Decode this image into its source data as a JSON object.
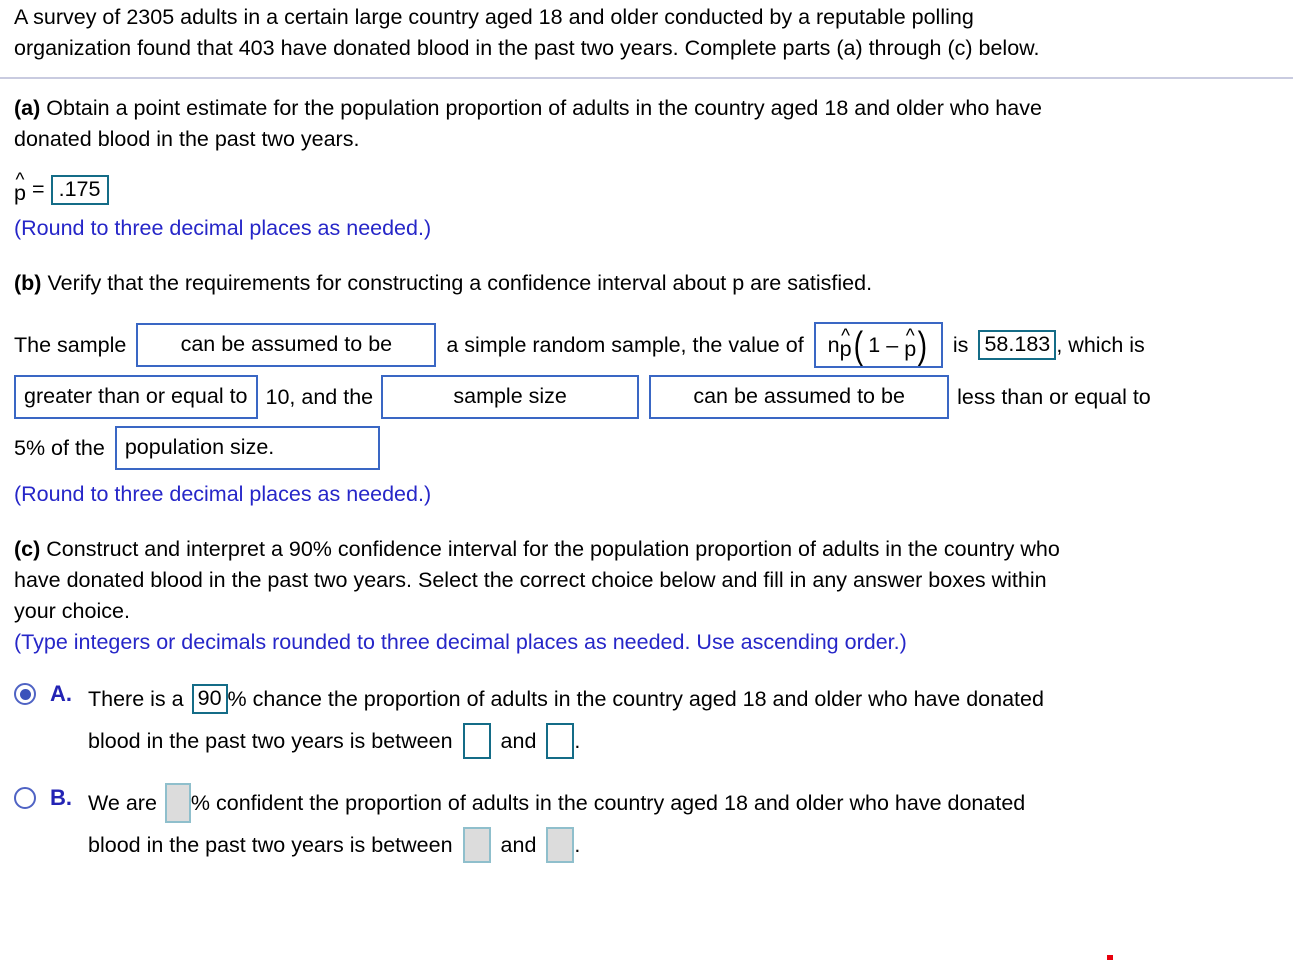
{
  "problem": {
    "line1": "A survey of 2305 adults in a certain large country aged 18 and older conducted by a reputable polling",
    "line2": "organization found that 403 have donated blood in the past two years. Complete parts (a) through (c) below."
  },
  "part_a": {
    "label": "(a)",
    "text_line1": "Obtain a point estimate for the population proportion of adults in the country aged 18 and older who have",
    "text_line2": "donated blood in the past two years.",
    "phat_symbol": "p",
    "equals": "=",
    "phat_value": ".175",
    "round_note": "(Round to three decimal places as needed.)"
  },
  "part_b": {
    "label": "(b)",
    "text": "Verify that the requirements for constructing a confidence interval about p are satisfied.",
    "line1": {
      "prefix": "The sample",
      "dropdown1": "can be assumed to be",
      "mid": "a simple random sample, the value of",
      "formula": {
        "n": "n",
        "phat1": "p",
        "open_paren": "(",
        "one": "1",
        "minus": "–",
        "phat2": "p",
        "close_paren": ")"
      },
      "is_word": "is",
      "value": "58.183",
      "suffix": ", which is"
    },
    "line2": {
      "dropdown2": "greater than or equal to",
      "mid1": "10, and the",
      "dropdown3": "sample size",
      "dropdown4": "can be assumed to be",
      "suffix": "less than or equal to"
    },
    "line3": {
      "prefix": "5% of the",
      "dropdown5": "population size."
    },
    "round_note": "(Round to three decimal places as needed.)"
  },
  "part_c": {
    "label": "(c)",
    "text_line1": "Construct and interpret a 90% confidence interval for the population proportion of adults in the country who",
    "text_line2": "have donated blood in the past two years. Select the correct choice below and fill in any answer boxes within",
    "text_line3": "your choice.",
    "round_note": "(Type integers or decimals rounded to three decimal places as needed. Use ascending order.)",
    "choices": [
      {
        "letter": "A.",
        "selected": true,
        "line1_before": "There is a",
        "value": "90",
        "line1_after": "% chance the proportion of adults in the country aged 18 and older who have donated",
        "line2_before": "blood in the past two years is between",
        "line2_mid": "and",
        "line2_after": ".",
        "box_lower": "",
        "box_upper": ""
      },
      {
        "letter": "B.",
        "selected": false,
        "line1_before": "We are",
        "value": "",
        "line1_after": "% confident the proportion of adults in the country aged 18 and older who have donated",
        "line2_before": "blood in the past two years is between",
        "line2_mid": "and",
        "line2_after": ".",
        "box_lower": "",
        "box_upper": ""
      }
    ]
  },
  "colors": {
    "answer_box_border": "#146c87",
    "dropdown_border": "#3a67c4",
    "note_text": "#2626c8",
    "choice_letter": "#2323b4",
    "radio": "#3a52bb",
    "disabled_fill": "#dcdcdc",
    "divider": "#c9cbe0"
  }
}
